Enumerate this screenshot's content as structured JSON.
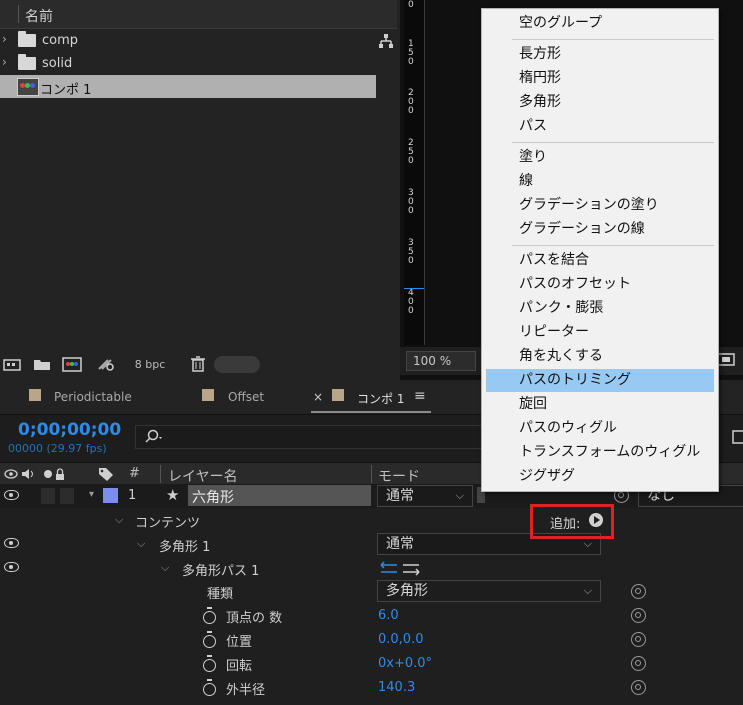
{
  "project": {
    "column_name": "名前",
    "items": [
      {
        "name": "comp",
        "type": "folder"
      },
      {
        "name": "solid",
        "type": "folder"
      },
      {
        "name": "コンポ 1",
        "type": "composition"
      }
    ],
    "bpc": "8 bpc"
  },
  "viewer": {
    "zoom": "100 %",
    "ruler_labels": [
      "0",
      "1\n5\n0",
      "2\n0\n0",
      "2\n5\n0",
      "3\n0\n0",
      "3\n5\n0",
      "4\n0\n0"
    ]
  },
  "timeline": {
    "tabs": [
      "Periodictable",
      "Offset",
      "コンポ 1"
    ],
    "active_tab_close": "×",
    "timecode": "0;00;00;00",
    "fps": "00000 (29.97 fps)",
    "columns": {
      "number": "#",
      "layer_name": "レイヤー名",
      "mode": "モード"
    },
    "layer": {
      "index": "1",
      "name": "六角形",
      "mode": "通常",
      "parent": "なし"
    },
    "contents_label": "コンテンツ",
    "add_label": "追加:",
    "group": {
      "name": "多角形 1",
      "mode": "通常"
    },
    "path": {
      "name": "多角形パス 1"
    },
    "properties": [
      {
        "label": "種類",
        "value": "多角形",
        "kind": "dropdown"
      },
      {
        "label": "頂点の 数",
        "value": "6.0"
      },
      {
        "label": "位置",
        "value": "0.0,0.0"
      },
      {
        "label": "回転",
        "value": "0x+0.0°"
      },
      {
        "label": "外半径",
        "value": "140.3"
      }
    ]
  },
  "menu": {
    "groups": [
      [
        "空のグループ"
      ],
      [
        "長方形",
        "楕円形",
        "多角形",
        "パス"
      ],
      [
        "塗り",
        "線",
        "グラデーションの塗り",
        "グラデーションの線"
      ],
      [
        "パスを結合",
        "パスのオフセット",
        "パンク・膨張",
        "リピーター",
        "角を丸くする",
        "パスのトリミング",
        "旋回",
        "パスのウィグル",
        "トランスフォームのウィグル",
        "ジグザグ"
      ]
    ],
    "highlighted": "パスのトリミング"
  },
  "colors": {
    "accent_blue": "#2d8ceb",
    "highlight": "#98c9f2",
    "callout_red": "#e1221f",
    "label_swatch": "#b9a588",
    "layer_color": "#7b8df0"
  }
}
